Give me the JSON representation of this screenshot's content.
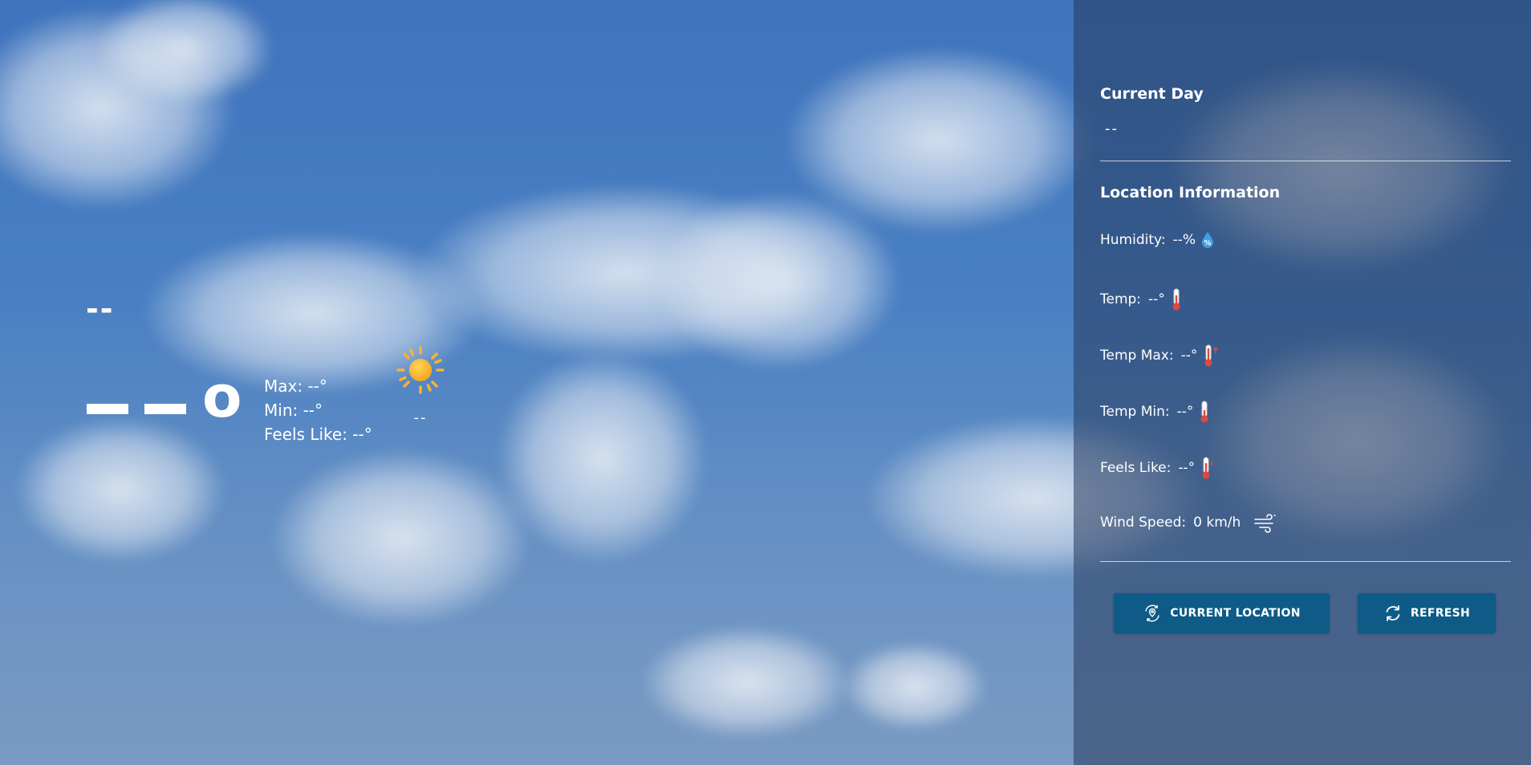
{
  "main": {
    "city": "--",
    "temp_dashes": "--",
    "temp_unit": "o",
    "max": "Max: --°",
    "min": "Min: --°",
    "feels_like": "Feels Like: --°",
    "condition_icon": "sun-icon",
    "condition_text": "--"
  },
  "panel": {
    "current_day_title": "Current Day",
    "current_day_value": "--",
    "location_title": "Location Information",
    "rows": [
      {
        "label": "Humidity:",
        "value": "--%",
        "icon": "humidity-drop-icon"
      },
      {
        "label": "Temp:",
        "value": "--°",
        "icon": "thermometer-icon"
      },
      {
        "label": "Temp Max:",
        "value": "--°",
        "icon": "thermometer-up-icon"
      },
      {
        "label": "Temp Min:",
        "value": "--°",
        "icon": "thermometer-down-icon"
      },
      {
        "label": "Feels Like:",
        "value": "--°",
        "icon": "thermometer-feels-icon"
      },
      {
        "label": "Wind Speed:",
        "value": "0 km/h",
        "icon": "wind-icon"
      }
    ],
    "buttons": {
      "current_location": "CURRENT LOCATION",
      "refresh": "REFRESH"
    }
  },
  "colors": {
    "button_bg": "#0e5b87",
    "panel_bg": "#263a5c",
    "sun": "#f7b52b",
    "thermometer": "#e0473f",
    "drop": "#3aa0e8"
  }
}
